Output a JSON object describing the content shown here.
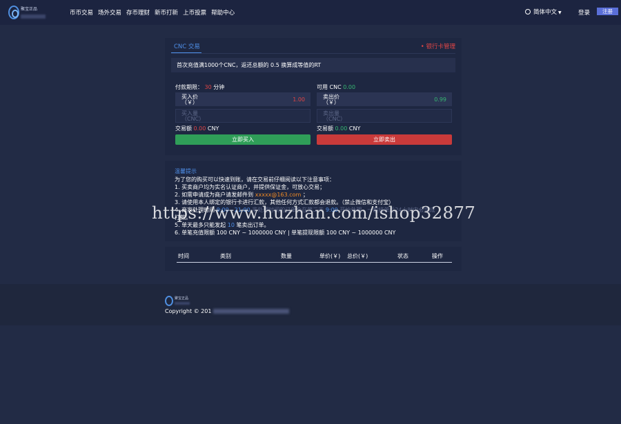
{
  "header": {
    "logo_title": "聚宝正品",
    "nav": [
      "币币交易",
      "场外交易",
      "存币理财",
      "新币打新",
      "上币投票",
      "帮助中心"
    ],
    "language": "简体中文",
    "login": "登录",
    "register": "注册"
  },
  "trade": {
    "tab": "CNC 交易",
    "bank_link": "• 银行卡管理",
    "notice": "首次充值满1000个CNC，返还总额的 0.5 换算成等值的RT",
    "buy": {
      "limit_prefix": "付款期限：",
      "limit_value": "30",
      "limit_suffix": "分钟",
      "price_label": "买入价",
      "price_unit": "（￥）",
      "price_value": "1.00",
      "amount_placeholder": "买入量",
      "amount_unit": "（CNC）",
      "total_label": "交易额",
      "total_value": "0.00",
      "total_unit": "CNY",
      "button": "立即买入"
    },
    "sell": {
      "available_label": "可用 CNC",
      "available_value": "0.00",
      "price_label": "卖出价",
      "price_unit": "（￥）",
      "price_value": "0.99",
      "amount_placeholder": "卖出量",
      "amount_unit": "（CNC）",
      "total_label": "交易额",
      "total_value": "0.00",
      "total_unit": "CNY",
      "button": "立即卖出"
    }
  },
  "tips": {
    "title": "温馨提示",
    "intro": "为了您的购买可以快速到账，请在交易前仔细阅读以下注意事项：",
    "item1": "1. 买卖商户均为实名认证商户，并提供保证金，可放心交易；",
    "item2_prefix": "2. 如需申请成为商户请发邮件到",
    "item2_email": "xxxxx@163.com",
    "item2_suffix": "；",
    "item3": "3. 请使用本人绑定的银行卡进行汇款，其他任何方式汇款都会退款。（禁止微信和支付宝）",
    "item4_prefix": "4. 商家处理时间",
    "item4_time1": "9:00 - 21:00",
    "item4_mid": "非处理时间的订单会在第二天",
    "item4_time2": "9:00",
    "item4_suffix": "开始处理，一般接单后24小时内会完成",
    "item4_tail": "打款。",
    "item5_prefix": "5. 单天最多只能发起",
    "item5_count": "10",
    "item5_suffix": "笔卖出订单。",
    "item6": "6. 单笔充值限额 100 CNY ~ 1000000 CNY  |  单笔提现限额 100 CNY ~ 1000000 CNY"
  },
  "orders_table": {
    "columns": [
      "时间",
      "类别",
      "数量",
      "单价(￥)",
      "总价(￥)",
      "状态",
      "操作"
    ]
  },
  "watermark": "https://www.huzhan.com/ishop32877",
  "footer": {
    "logo_title": "聚宝正品",
    "copyright_prefix": "Copyright © 201"
  },
  "colors": {
    "background": "#222b45",
    "panel": "#1e2741",
    "accent_blue": "#4f8fe8",
    "buy_green": "#2f9e58",
    "sell_red": "#c93a3a",
    "email_orange": "#f08a24"
  }
}
